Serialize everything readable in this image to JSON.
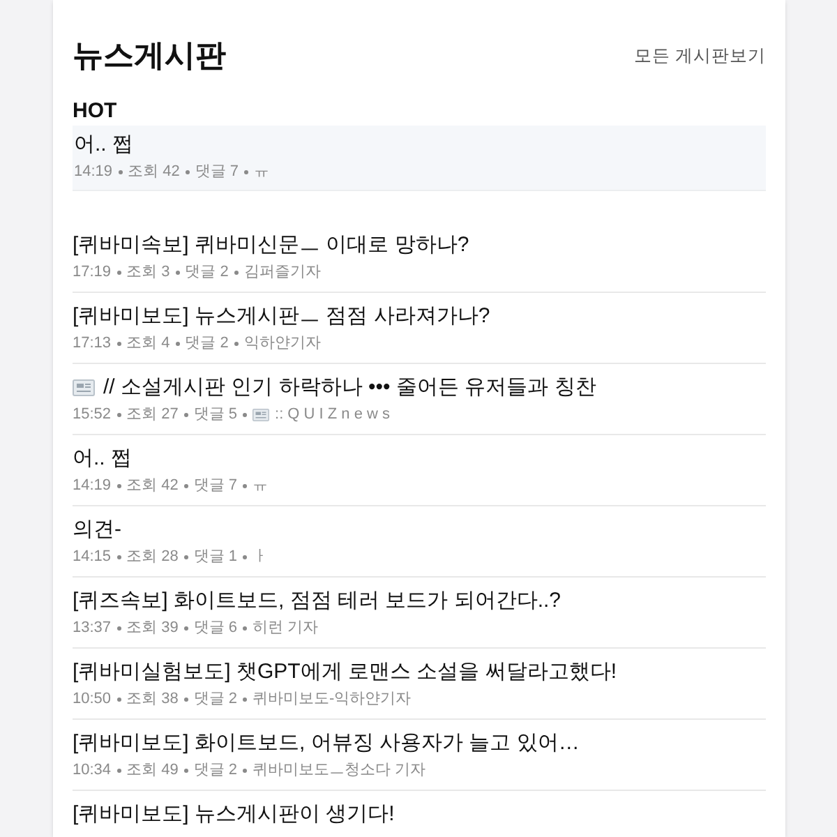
{
  "header": {
    "title": "뉴스게시판",
    "link": "모든 게시판보기"
  },
  "hot": {
    "label": "HOT",
    "posts": [
      {
        "title": "어.. 쩝",
        "meta": [
          "14:19",
          "조회 42",
          "댓글 7",
          "ㅠ"
        ]
      }
    ]
  },
  "posts": [
    {
      "title": "[퀴바미속보] 퀴바미신문ㅡ 이대로 망하나?",
      "meta": [
        "17:19",
        "조회 3",
        "댓글 2",
        "김퍼즐기자"
      ]
    },
    {
      "title": "[퀴바미보도] 뉴스게시판ㅡ 점점 사라져가나?",
      "meta": [
        "17:13",
        "조회 4",
        "댓글 2",
        "익하얀기자"
      ]
    },
    {
      "title": "// 소설게시판 인기 하락하나 ••• 줄어든 유저들과 칭찬",
      "kind": "news",
      "meta": [
        "15:52",
        "조회 27",
        "댓글 5",
        ":: Q U I Z n e w s"
      ]
    },
    {
      "title": "어.. 쩝",
      "meta": [
        "14:19",
        "조회 42",
        "댓글 7",
        "ㅠ"
      ]
    },
    {
      "title": "의견-",
      "meta": [
        "14:15",
        "조회 28",
        "댓글 1",
        "ㅏ"
      ]
    },
    {
      "title": "[퀴즈속보] 화이트보드, 점점 테러 보드가 되어간다..?",
      "meta": [
        "13:37",
        "조회 39",
        "댓글 6",
        "히런 기자"
      ]
    },
    {
      "title": "[퀴바미실험보도] 챗GPT에게 로맨스 소설을 써달라고했다!",
      "meta": [
        "10:50",
        "조회 38",
        "댓글 2",
        "퀴바미보도-익하얀기자"
      ]
    },
    {
      "title": "[퀴바미보도] 화이트보드, 어뷰징 사용자가 늘고 있어…",
      "meta": [
        "10:34",
        "조회 49",
        "댓글 2",
        "퀴바미보도ㅡ청소다 기자"
      ]
    },
    {
      "title": "[퀴바미보도] 뉴스게시판이 생기다!"
    }
  ]
}
